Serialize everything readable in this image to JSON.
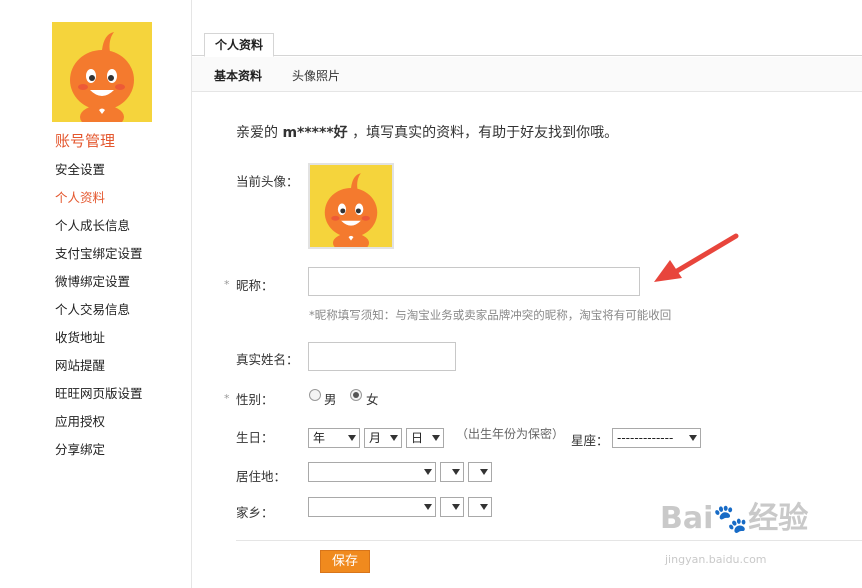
{
  "sidebar": {
    "title": "账号管理",
    "items": [
      {
        "label": "安全设置",
        "active": false
      },
      {
        "label": "个人资料",
        "active": true
      },
      {
        "label": "个人成长信息",
        "active": false
      },
      {
        "label": "支付宝绑定设置",
        "active": false
      },
      {
        "label": "微博绑定设置",
        "active": false
      },
      {
        "label": "个人交易信息",
        "active": false
      },
      {
        "label": "收货地址",
        "active": false
      },
      {
        "label": "网站提醒",
        "active": false
      },
      {
        "label": "旺旺网页版设置",
        "active": false
      },
      {
        "label": "应用授权",
        "active": false
      },
      {
        "label": "分享绑定",
        "active": false
      }
    ]
  },
  "tabs": {
    "main": "个人资料",
    "sub": [
      "基本资料",
      "头像照片"
    ]
  },
  "greeting": {
    "prefix": "亲爱的 ",
    "username": "m*****好",
    "suffix": " ，填写真实的资料，有助于好友找到你哦。"
  },
  "form": {
    "current_avatar_label": "当前头像：",
    "required_mark": "*",
    "nickname_label": "昵称：",
    "nickname_value": "",
    "nickname_hint": "*昵称填写须知：与淘宝业务或卖家品牌冲突的昵称，淘宝将有可能收回",
    "realname_label": "真实姓名：",
    "realname_value": "",
    "gender_label": "性别：",
    "gender_options": [
      "男",
      "女"
    ],
    "gender_selected": "女",
    "birthday_label": "生日：",
    "birthday_year": "年",
    "birthday_month": "月",
    "birthday_day": "日",
    "birthday_note": "（出生年份为保密）",
    "zodiac_label": "星座：",
    "zodiac_value": "-------------",
    "residence_label": "居住地：",
    "hometown_label": "家乡：",
    "save_label": "保存"
  },
  "watermark": {
    "line1": "Bai",
    "line2": "经验",
    "line3": "jingyan.baidu.com"
  },
  "colors": {
    "accent": "#e4572e",
    "button": "#f08a1e",
    "arrow": "#e8453c"
  }
}
